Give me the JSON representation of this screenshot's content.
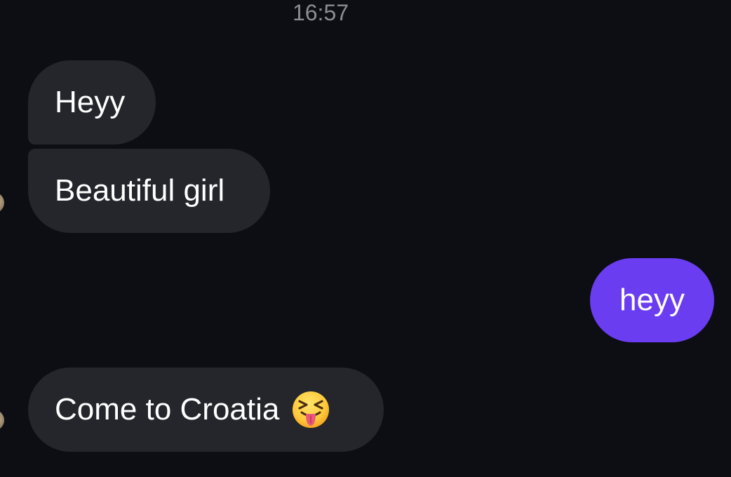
{
  "conversation": {
    "timestamp": "16:57",
    "messages": [
      {
        "direction": "incoming",
        "text": "Heyy"
      },
      {
        "direction": "incoming",
        "text": "Beautiful girl"
      },
      {
        "direction": "outgoing",
        "text": "heyy"
      },
      {
        "direction": "incoming",
        "text": "Come to Croatia",
        "emoji": "squinting-face-with-tongue-icon"
      }
    ]
  },
  "colors": {
    "background": "#0c0e13",
    "incoming_bubble": "#24262b",
    "outgoing_bubble": "#6a3df1",
    "timestamp_text": "#8a8d94",
    "message_text": "#ffffff"
  }
}
